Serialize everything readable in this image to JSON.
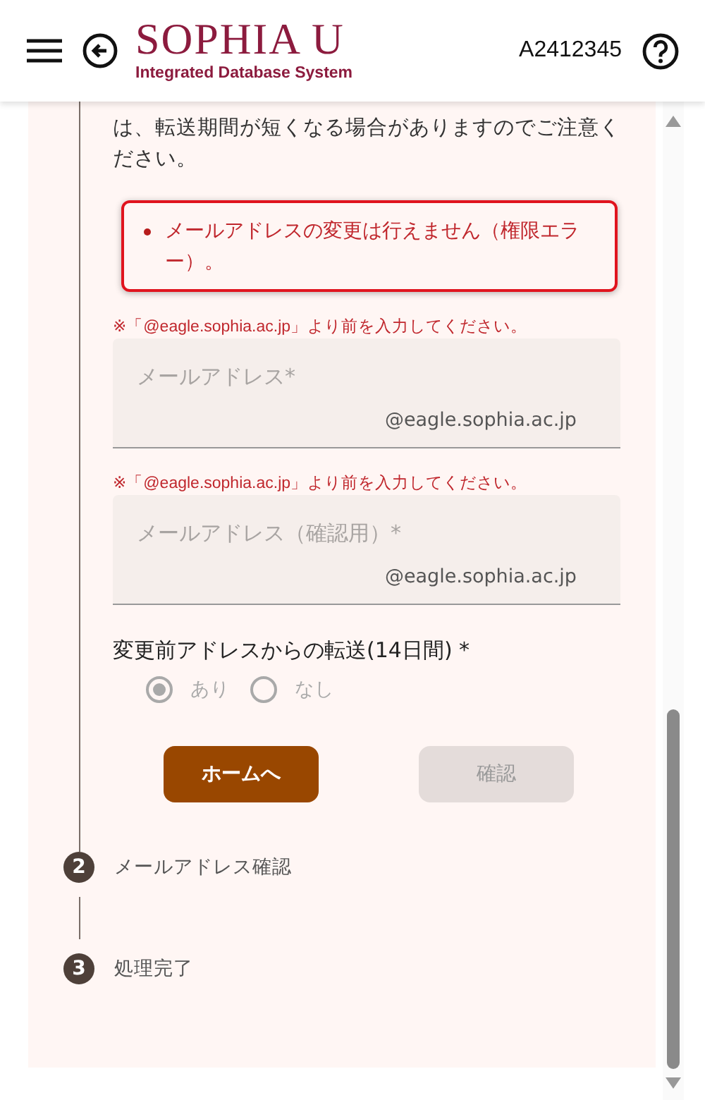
{
  "header": {
    "logo": {
      "title": "SOPHIA U",
      "subtitle": "Integrated Database System"
    },
    "user_id": "A2412345"
  },
  "notice": "は、転送期間が短くなる場合がありますのでご注意ください。",
  "errors": [
    "メールアドレスの変更は行えません（権限エラー）。"
  ],
  "fields": [
    {
      "hint": "※「@eagle.sophia.ac.jp」より前を入力してください。",
      "placeholder": "メールアドレス*",
      "suffix": "@eagle.sophia.ac.jp",
      "disabled": true
    },
    {
      "hint": "※「@eagle.sophia.ac.jp」より前を入力してください。",
      "placeholder": "メールアドレス（確認用）*",
      "suffix": "@eagle.sophia.ac.jp",
      "disabled": true
    }
  ],
  "forwarding": {
    "label": "変更前アドレスからの転送(14日間) *",
    "options": [
      {
        "label": "あり",
        "selected": true,
        "disabled": true
      },
      {
        "label": "なし",
        "selected": false,
        "disabled": true
      }
    ]
  },
  "buttons": [
    {
      "label": "ホームへ",
      "disabled": false
    },
    {
      "label": "確認",
      "disabled": true
    }
  ],
  "steps": [
    {
      "number": "2",
      "label": "メールアドレス確認"
    },
    {
      "number": "3",
      "label": "処理完了"
    }
  ]
}
